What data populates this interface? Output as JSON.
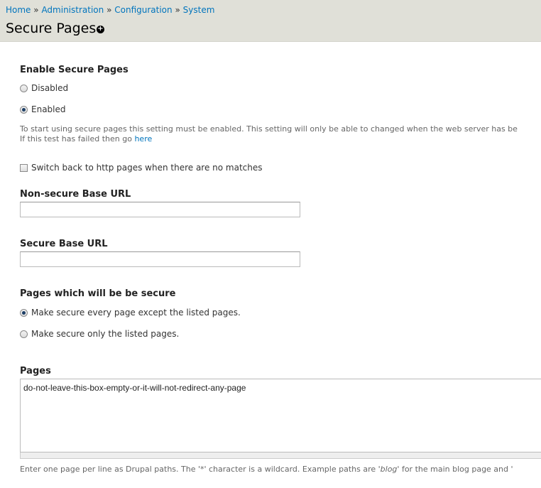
{
  "breadcrumb": {
    "items": [
      "Home",
      "Administration",
      "Configuration",
      "System"
    ],
    "separator": "»"
  },
  "page": {
    "title": "Secure Pages",
    "shortcut_icon": "add-shortcut-icon"
  },
  "enable": {
    "label": "Enable Secure Pages",
    "options": [
      {
        "label": "Disabled",
        "selected": false
      },
      {
        "label": "Enabled",
        "selected": true
      }
    ],
    "description_line1": "To start using secure pages this setting must be enabled. This setting will only be able to changed when the web server has be",
    "description_line2_prefix": "If this test has failed then go ",
    "description_link": "here"
  },
  "switch_back": {
    "label": "Switch back to http pages when there are no matches",
    "checked": false
  },
  "nonsecure_url": {
    "label": "Non-secure Base URL",
    "value": ""
  },
  "secure_url": {
    "label": "Secure Base URL",
    "value": ""
  },
  "pages_secure": {
    "label": "Pages which will be be secure",
    "options": [
      {
        "label": "Make secure every page except the listed pages.",
        "selected": true
      },
      {
        "label": "Make secure only the listed pages.",
        "selected": false
      }
    ]
  },
  "pages": {
    "label": "Pages",
    "value": "do-not-leave-this-box-empty-or-it-will-not-redirect-any-page",
    "description_prefix": "Enter one page per line as Drupal paths. The '*' character is a wildcard. Example paths are '",
    "description_em": "blog",
    "description_suffix": "' for the main blog page and '"
  },
  "colors": {
    "link": "#0074bd",
    "header_bg": "#e0e0d8"
  }
}
